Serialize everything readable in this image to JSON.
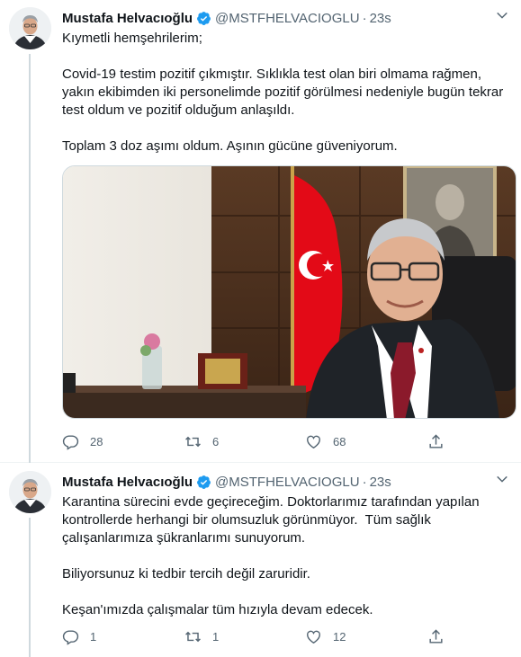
{
  "tweets": [
    {
      "author_name": "Mustafa Helvacıoğlu",
      "handle": "@MSTFHELVACIOGLU",
      "separator": "·",
      "time": "23s",
      "paragraphs": [
        "Kıymetli hemşehrilerim;",
        "Covid-19 testim pozitif çıkmıştır. Sıklıkla test olan biri olmama rağmen, yakın ekibimden iki personelimde pozitif görülmesi nedeniyle bugün tekrar test oldum ve pozitif olduğum anlaşıldı.",
        "Toplam 3 doz aşımı oldum. Aşının gücüne güveniyorum."
      ],
      "has_media": true,
      "replies": "28",
      "retweets": "6",
      "likes": "68"
    },
    {
      "author_name": "Mustafa Helvacıoğlu",
      "handle": "@MSTFHELVACIOGLU",
      "separator": "·",
      "time": "23s",
      "paragraphs": [
        "Karantina sürecini evde geçireceğim. Doktorlarımız tarafından yapılan kontrollerde herhangi bir olumsuzluk görünmüyor.  Tüm sağlık çalışanlarımıza şükranlarımı sunuyorum.",
        "Biliyorsunuz ki tedbir tercih değil zaruridir.",
        "Keşan'ımızda çalışmalar tüm hızıyla devam edecek."
      ],
      "has_media": false,
      "replies": "1",
      "retweets": "1",
      "likes": "12"
    }
  ],
  "icons": {
    "verified": "verified-badge-icon",
    "caret": "chevron-down-icon",
    "reply": "reply-icon",
    "retweet": "retweet-icon",
    "like": "heart-icon",
    "share": "share-icon"
  },
  "colors": {
    "verified_blue": "#1d9bf0",
    "secondary_text": "#536471",
    "flag_red": "#e30a17"
  }
}
